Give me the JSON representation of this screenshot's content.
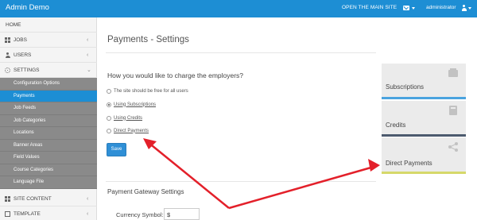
{
  "topbar": {
    "brand": "Admin Demo",
    "open_site": "OPEN THE MAIN SITE",
    "user": "administrator"
  },
  "sidebar": {
    "home": "HOME",
    "jobs": "JOBS",
    "users": "USERS",
    "settings": "SETTINGS",
    "sub": [
      "Configuration Options",
      "Payments",
      "Job Feeds",
      "Job Categories",
      "Locations",
      "Banner Areas",
      "Field Values",
      "Course Categories",
      "Language File"
    ],
    "site_content": "SITE CONTENT",
    "template": "TEMPLATE"
  },
  "main": {
    "title": "Payments - Settings",
    "question": "How you would like to charge the employers?",
    "options": [
      "The site should be free for all users",
      "Using Subscriptions",
      "Using Credits",
      "Direct Payments"
    ],
    "selected_option": "Using Subscriptions",
    "save": "Save",
    "gateway_title": "Payment Gateway Settings",
    "currency_label": "Currency Symbol:",
    "currency_value": "$"
  },
  "cards": [
    {
      "label": "Subscriptions",
      "color": "#4aa3df"
    },
    {
      "label": "Credits",
      "color": "#4c5a6e"
    },
    {
      "label": "Direct Payments",
      "color": "#d6d86a"
    }
  ],
  "annotation_color": "#e3202a"
}
